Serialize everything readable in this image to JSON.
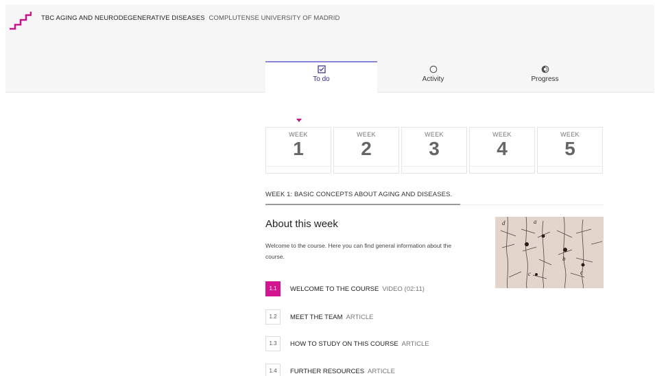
{
  "header": {
    "course_name": "TBC AGING AND NEURODEGENERATIVE DISEASES",
    "university": "COMPLUTENSE UNIVERSITY OF MADRID",
    "brand_color": "#c8148a"
  },
  "tabs": [
    {
      "label": "To do",
      "icon": "todo-checkbox-icon",
      "active": true
    },
    {
      "label": "Activity",
      "icon": "activity-circle-icon",
      "active": false
    },
    {
      "label": "Progress",
      "icon": "progress-ring-icon",
      "active": false
    }
  ],
  "weeks": {
    "label": "WEEK",
    "items": [
      "1",
      "2",
      "3",
      "4",
      "5"
    ],
    "selected": "1"
  },
  "week_heading": "WEEK 1: BASIC CONCEPTS ABOUT AGING AND DISEASES.",
  "about": {
    "title": "About this week",
    "text": "Welcome to the course. Here you can find general information about the course.",
    "image": "neuron-illustration"
  },
  "steps": [
    {
      "num": "1.1",
      "title": "WELCOME TO THE COURSE",
      "type": "VIDEO (02:11)",
      "current": true
    },
    {
      "num": "1.2",
      "title": "MEET THE TEAM",
      "type": "ARTICLE",
      "current": false
    },
    {
      "num": "1.3",
      "title": "HOW TO STUDY ON THIS COURSE",
      "type": "ARTICLE",
      "current": false
    },
    {
      "num": "1.4",
      "title": "FURTHER RESOURCES",
      "type": "ARTICLE",
      "current": false
    }
  ]
}
